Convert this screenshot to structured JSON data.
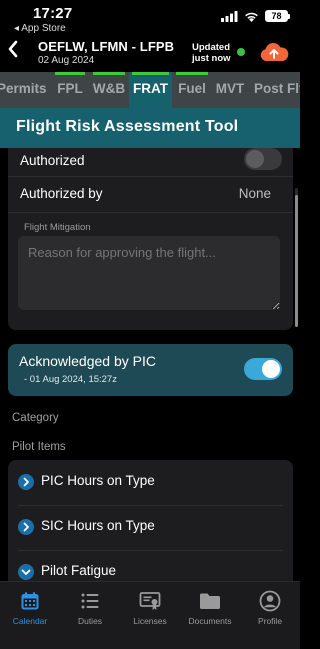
{
  "status_bar": {
    "time": "17:27",
    "back_link": "◂ App Store",
    "battery": "78"
  },
  "header": {
    "back_icon": "chevron-left-icon",
    "route": "OEFLW, LFMN - LFPB",
    "date": "02 Aug 2024",
    "sync_status_line1": "Updated",
    "sync_status_line2": "just now",
    "sync_color": "#37c443",
    "cloud_icon": "cloud-upload-icon",
    "cloud_color": "#f2663a"
  },
  "tabs": [
    {
      "label": "Permits",
      "active": false,
      "complete": false
    },
    {
      "label": "FPL",
      "active": false,
      "complete": true
    },
    {
      "label": "W&B",
      "active": false,
      "complete": true
    },
    {
      "label": "FRAT",
      "active": true,
      "complete": true
    },
    {
      "label": "Fuel",
      "active": false,
      "complete": true
    },
    {
      "label": "MVT",
      "active": false,
      "complete": false
    },
    {
      "label": "Post Flt",
      "active": false,
      "complete": false
    }
  ],
  "title": "Flight Risk Assessment Tool",
  "authorization": {
    "authorized_label": "Authorized",
    "authorized_on": false,
    "authorized_by_label": "Authorized by",
    "authorized_by_value": "None",
    "mitigation_label": "Flight Mitigation",
    "mitigation_placeholder": "Reason for approving the flight..."
  },
  "acknowledgement": {
    "label": "Acknowledged by PIC",
    "date": "- 01 Aug 2024, 15:27z",
    "on": true
  },
  "category_label": "Category",
  "pilot_items_label": "Pilot Items",
  "pilot_items": [
    {
      "label": "PIC Hours on Type",
      "icon": "chevron-right-icon"
    },
    {
      "label": "SIC Hours on Type",
      "icon": "chevron-right-icon"
    },
    {
      "label": "Pilot Fatigue",
      "icon": "chevron-down-icon"
    }
  ],
  "bottom_nav": [
    {
      "label": "Calendar",
      "icon": "calendar-icon",
      "active": true
    },
    {
      "label": "Duties",
      "icon": "list-icon",
      "active": false
    },
    {
      "label": "Licenses",
      "icon": "license-icon",
      "active": false
    },
    {
      "label": "Documents",
      "icon": "folder-icon",
      "active": false
    },
    {
      "label": "Profile",
      "icon": "person-icon",
      "active": false
    }
  ],
  "colors": {
    "accent": "#2d92e3",
    "teal": "#17616e",
    "tab_complete": "#3fc93a"
  }
}
